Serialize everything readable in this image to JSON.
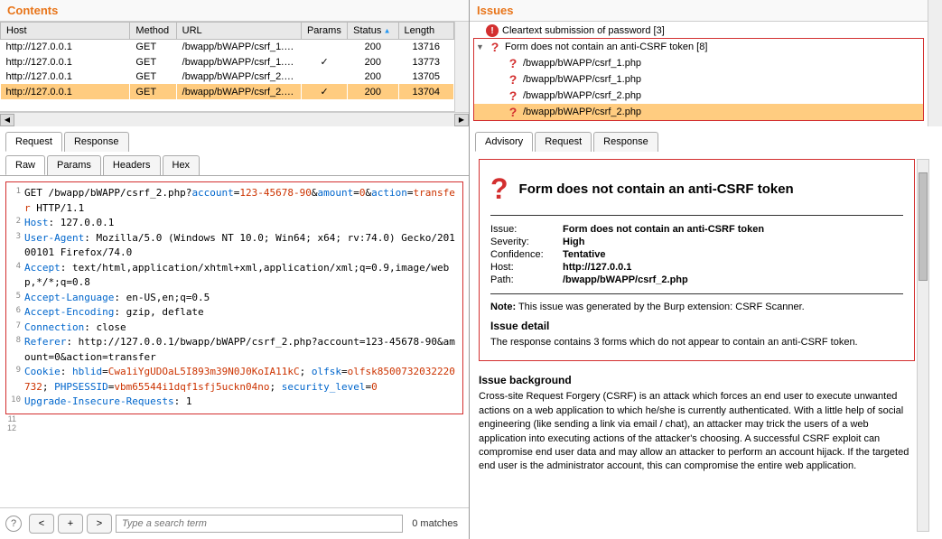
{
  "left": {
    "title": "Contents",
    "columns": [
      "Host",
      "Method",
      "URL",
      "Params",
      "Status",
      "Length"
    ],
    "sort_col": 4,
    "rows": [
      {
        "host": "http://127.0.0.1",
        "method": "GET",
        "url": "/bwapp/bWAPP/csrf_1.p...",
        "params": "",
        "status": "200",
        "length": "13716",
        "selected": false
      },
      {
        "host": "http://127.0.0.1",
        "method": "GET",
        "url": "/bwapp/bWAPP/csrf_1.p...",
        "params": "✓",
        "status": "200",
        "length": "13773",
        "selected": false
      },
      {
        "host": "http://127.0.0.1",
        "method": "GET",
        "url": "/bwapp/bWAPP/csrf_2.p...",
        "params": "",
        "status": "200",
        "length": "13705",
        "selected": false
      },
      {
        "host": "http://127.0.0.1",
        "method": "GET",
        "url": "/bwapp/bWAPP/csrf_2.p...",
        "params": "✓",
        "status": "200",
        "length": "13704",
        "selected": true
      }
    ],
    "tabs_outer": [
      "Request",
      "Response"
    ],
    "tabs_inner": [
      "Raw",
      "Params",
      "Headers",
      "Hex"
    ],
    "request_lines": [
      {
        "n": "1",
        "segs": [
          {
            "t": "GET /bwapp/bWAPP/csrf_2.php?"
          },
          {
            "t": "account",
            "c": "param-name"
          },
          {
            "t": "="
          },
          {
            "t": "123-45678-90",
            "c": "param-val"
          },
          {
            "t": "&"
          },
          {
            "t": "amount",
            "c": "param-name"
          },
          {
            "t": "="
          },
          {
            "t": "0",
            "c": "param-val"
          },
          {
            "t": "&"
          },
          {
            "t": "action",
            "c": "param-name"
          },
          {
            "t": "="
          },
          {
            "t": "transfer",
            "c": "param-val"
          },
          {
            "t": " HTTP/1.1"
          }
        ]
      },
      {
        "n": "2",
        "segs": [
          {
            "t": "Host",
            "c": "param-name"
          },
          {
            "t": ": 127.0.0.1"
          }
        ]
      },
      {
        "n": "3",
        "segs": [
          {
            "t": "User-Agent",
            "c": "param-name"
          },
          {
            "t": ": Mozilla/5.0 (Windows NT 10.0; Win64; x64; rv:74.0) Gecko/20100101 Firefox/74.0"
          }
        ]
      },
      {
        "n": "4",
        "segs": [
          {
            "t": "Accept",
            "c": "param-name"
          },
          {
            "t": ": text/html,application/xhtml+xml,application/xml;q=0.9,image/webp,*/*;q=0.8"
          }
        ]
      },
      {
        "n": "5",
        "segs": [
          {
            "t": "Accept-Language",
            "c": "param-name"
          },
          {
            "t": ": en-US,en;q=0.5"
          }
        ]
      },
      {
        "n": "6",
        "segs": [
          {
            "t": "Accept-Encoding",
            "c": "param-name"
          },
          {
            "t": ": gzip, deflate"
          }
        ]
      },
      {
        "n": "7",
        "segs": [
          {
            "t": "Connection",
            "c": "param-name"
          },
          {
            "t": ": close"
          }
        ]
      },
      {
        "n": "8",
        "segs": [
          {
            "t": "Referer",
            "c": "param-name"
          },
          {
            "t": ": http://127.0.0.1/bwapp/bWAPP/csrf_2.php?account=123-45678-90&amount=0&action=transfer"
          }
        ]
      },
      {
        "n": "9",
        "segs": [
          {
            "t": "Cookie",
            "c": "param-name"
          },
          {
            "t": ": "
          },
          {
            "t": "hblid",
            "c": "param-name"
          },
          {
            "t": "="
          },
          {
            "t": "Cwa1iYgUDOaL5I893m39N0J0KoIA11kC",
            "c": "param-val"
          },
          {
            "t": "; "
          },
          {
            "t": "olfsk",
            "c": "param-name"
          },
          {
            "t": "="
          },
          {
            "t": "olfsk8500732032220732",
            "c": "param-val"
          },
          {
            "t": "; "
          },
          {
            "t": "PHPSESSID",
            "c": "param-name"
          },
          {
            "t": "="
          },
          {
            "t": "vbm65544i1dqf1sfj5uckn04no",
            "c": "param-val"
          },
          {
            "t": "; "
          },
          {
            "t": "security_level",
            "c": "param-name"
          },
          {
            "t": "="
          },
          {
            "t": "0",
            "c": "param-val"
          }
        ]
      },
      {
        "n": "10",
        "segs": [
          {
            "t": "Upgrade-Insecure-Requests",
            "c": "param-name"
          },
          {
            "t": ": 1"
          }
        ]
      }
    ],
    "extra_line_nums": [
      "11",
      "12"
    ],
    "search_placeholder": "Type a search term",
    "matches": "0 matches"
  },
  "right": {
    "title": "Issues",
    "tree": [
      {
        "indent": 0,
        "icon": "red",
        "disclosure": "",
        "text": "Cleartext submission of password [3]",
        "boxed": false
      },
      {
        "indent": 0,
        "icon": "q",
        "disclosure": "▼",
        "text": "Form does not contain an anti-CSRF token [8]",
        "boxed": true
      },
      {
        "indent": 1,
        "icon": "q",
        "disclosure": "",
        "text": "/bwapp/bWAPP/csrf_1.php",
        "boxed": true
      },
      {
        "indent": 1,
        "icon": "q",
        "disclosure": "",
        "text": "/bwapp/bWAPP/csrf_1.php",
        "boxed": true
      },
      {
        "indent": 1,
        "icon": "q",
        "disclosure": "",
        "text": "/bwapp/bWAPP/csrf_2.php",
        "boxed": true
      },
      {
        "indent": 1,
        "icon": "q",
        "disclosure": "",
        "text": "/bwapp/bWAPP/csrf_2.php",
        "boxed": true,
        "selected": true
      }
    ],
    "tabs": [
      "Advisory",
      "Request",
      "Response"
    ],
    "advisory": {
      "title": "Form does not contain an anti-CSRF token",
      "meta": [
        {
          "label": "Issue:",
          "value": "Form does not contain an anti-CSRF token"
        },
        {
          "label": "Severity:",
          "value": "High"
        },
        {
          "label": "Confidence:",
          "value": "Tentative"
        },
        {
          "label": "Host:",
          "value": "http://127.0.0.1"
        },
        {
          "label": "Path:",
          "value": "/bwapp/bWAPP/csrf_2.php"
        }
      ],
      "note_label": "Note:",
      "note_text": " This issue was generated by the Burp extension: CSRF Scanner.",
      "detail_title": "Issue detail",
      "detail_text": "The response contains 3 forms which do not appear to contain an anti-CSRF token.",
      "bg_title": "Issue background",
      "bg_text": "Cross-site Request Forgery (CSRF) is an attack which forces an end user to execute unwanted actions on a web application to which he/she is currently authenticated. With a little help of social engineering (like sending a link via email / chat), an attacker may trick the users of a web application into executing actions of the attacker's choosing. A successful CSRF exploit can compromise end user data and may allow an attacker to perform an account hijack. If the targeted end user is the administrator account, this can compromise the entire web application."
    }
  }
}
